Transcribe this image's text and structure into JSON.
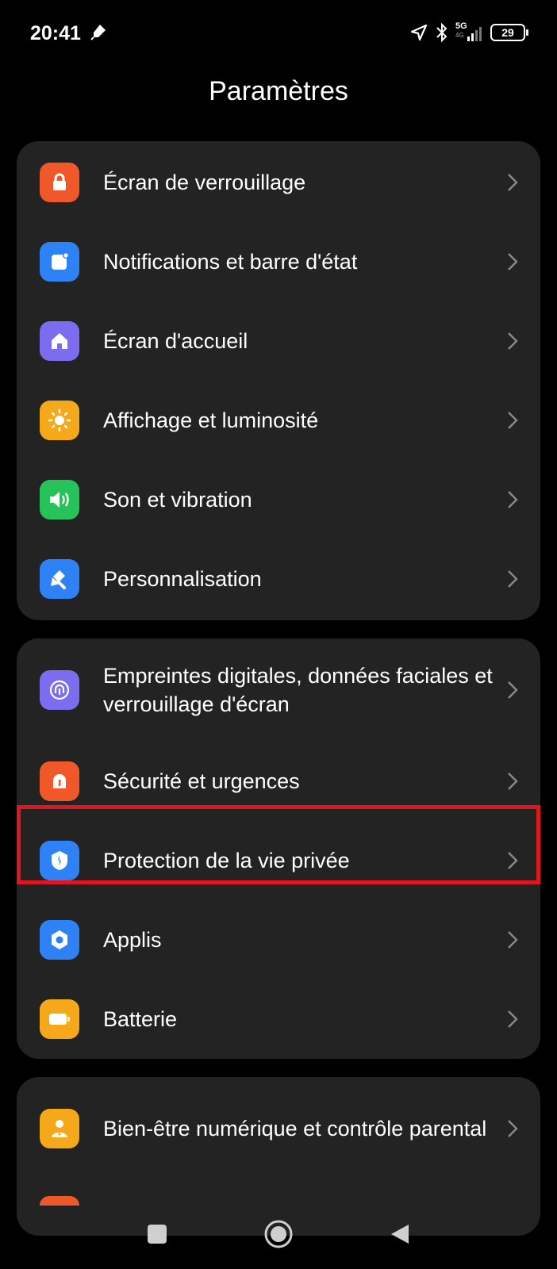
{
  "status_bar": {
    "time": "20:41",
    "network": "5G",
    "network_sub": "4G",
    "battery": "29",
    "icons": [
      "pen-icon",
      "location-arrow-icon",
      "bluetooth-icon",
      "signal-icon",
      "battery-icon"
    ]
  },
  "page": {
    "title": "Paramètres"
  },
  "groups": [
    {
      "items": [
        {
          "label": "Écran de verrouillage",
          "icon": "lock-icon",
          "color": "#f0582a"
        },
        {
          "label": "Notifications et barre d'état",
          "icon": "notification-icon",
          "color": "#2f82f5"
        },
        {
          "label": "Écran d'accueil",
          "icon": "home-icon",
          "color": "#7c6cf0"
        },
        {
          "label": "Affichage et luminosité",
          "icon": "sun-icon",
          "color": "#f6a81b"
        },
        {
          "label": "Son et vibration",
          "icon": "speaker-icon",
          "color": "#26c25a"
        },
        {
          "label": "Personnalisation",
          "icon": "brush-icon",
          "color": "#2f82f5"
        }
      ]
    },
    {
      "items": [
        {
          "label": "Empreintes digitales, données faciales et verrouillage d'écran",
          "icon": "fingerprint-icon",
          "color": "#7c6cf0"
        },
        {
          "label": "Sécurité et urgences",
          "icon": "alarm-icon",
          "color": "#f0582a"
        },
        {
          "label": "Protection de la vie privée",
          "icon": "privacy-shield-icon",
          "color": "#2f82f5"
        },
        {
          "label": "Applis",
          "icon": "apps-hexagon-icon",
          "color": "#2f82f5"
        },
        {
          "label": "Batterie",
          "icon": "battery-icon",
          "color": "#f6a81b"
        }
      ]
    },
    {
      "items": [
        {
          "label": "Bien-être numérique et contrôle parental",
          "icon": "wellbeing-icon",
          "color": "#f6a81b"
        }
      ]
    }
  ],
  "highlighted_item": "Protection de la vie privée",
  "nav_bar": {
    "buttons": [
      "recents-square-icon",
      "home-circle-icon",
      "back-triangle-icon"
    ]
  }
}
